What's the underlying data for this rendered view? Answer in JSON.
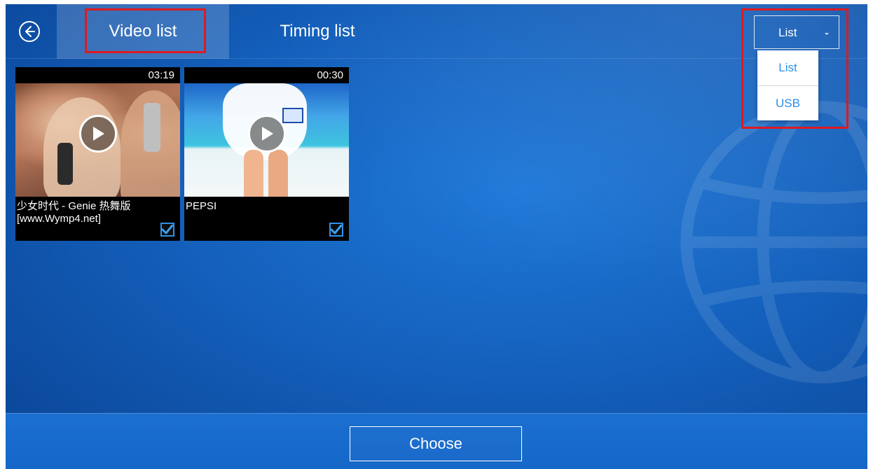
{
  "topbar": {
    "back_icon": "back-arrow-circle-icon",
    "tabs": [
      {
        "label": "Video list",
        "selected": true
      },
      {
        "label": "Timing list",
        "selected": false
      }
    ]
  },
  "source_select": {
    "value": "List",
    "options": [
      "List",
      "USB"
    ]
  },
  "videos": [
    {
      "duration": "03:19",
      "title": "少女时代 - Genie 热舞版[www.Wymp4.net]",
      "checked": true
    },
    {
      "duration": "00:30",
      "title": "PEPSI",
      "checked": true
    }
  ],
  "footer": {
    "choose_label": "Choose"
  },
  "colors": {
    "background": "#1461bd",
    "highlight_box": "#e0191e",
    "dropdown_text": "#2a8fe8",
    "checkbox_accent": "#2e92e8"
  }
}
